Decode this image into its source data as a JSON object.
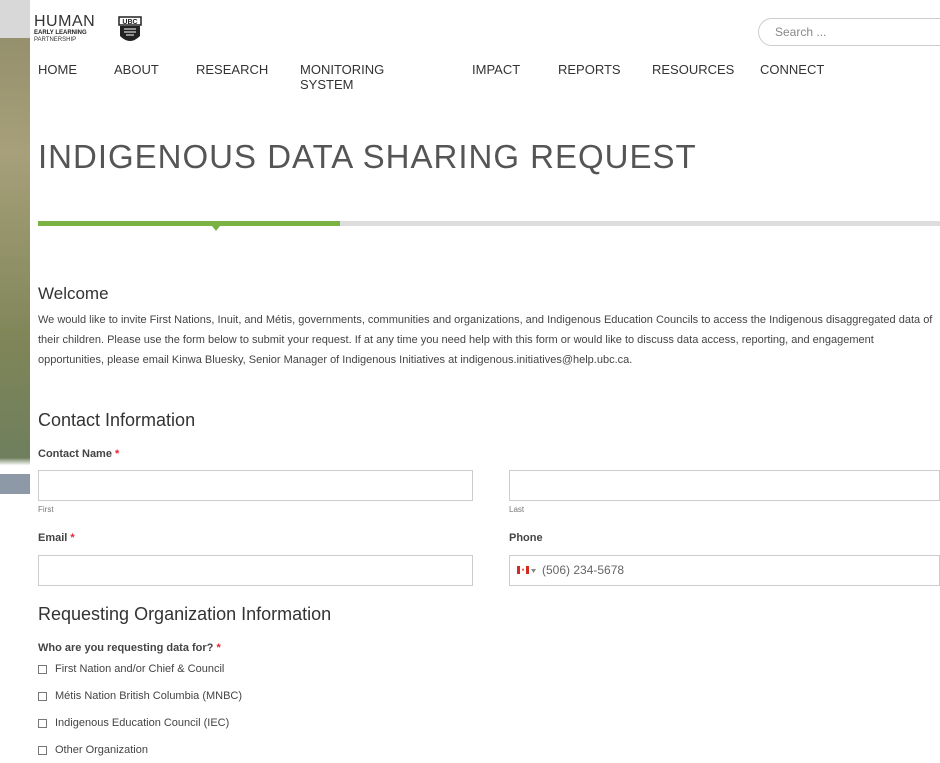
{
  "header": {
    "logo": {
      "line1": "HUMAN",
      "line2": "EARLY LEARNING",
      "line3": "PARTNERSHIP"
    },
    "search_placeholder": "Search ...",
    "nav": [
      "HOME",
      "ABOUT",
      "RESEARCH",
      "MONITORING SYSTEM",
      "IMPACT",
      "REPORTS",
      "RESOURCES",
      "CONNECT"
    ]
  },
  "page": {
    "title": "INDIGENOUS DATA SHARING REQUEST",
    "progress": 0.33,
    "accent_color": "#7ab243"
  },
  "welcome": {
    "heading": "Welcome",
    "text": "We would like to invite First Nations, Inuit, and Métis, governments, communities and organizations, and Indigenous Education Councils to access the Indigenous disaggregated data of their children. Please use the form below to submit your request. If at any time you need help with this form or would like to discuss data access, reporting, and engagement opportunities, please email Kinwa Bluesky, Senior Manager of Indigenous Initiatives at indigenous.initiatives@help.ubc.ca."
  },
  "contact": {
    "heading": "Contact Information",
    "name_label": "Contact Name",
    "required_mark": "*",
    "first_sub": "First",
    "last_sub": "Last",
    "email_label": "Email",
    "phone_label": "Phone",
    "phone_placeholder": "(506) 234-5678"
  },
  "organization": {
    "heading": "Requesting Organization Information",
    "question": "Who are you requesting data for?",
    "options": [
      "First Nation and/or Chief & Council",
      "Métis Nation British Columbia (MNBC)",
      "Indigenous Education Council (IEC)",
      "Other Organization"
    ]
  }
}
